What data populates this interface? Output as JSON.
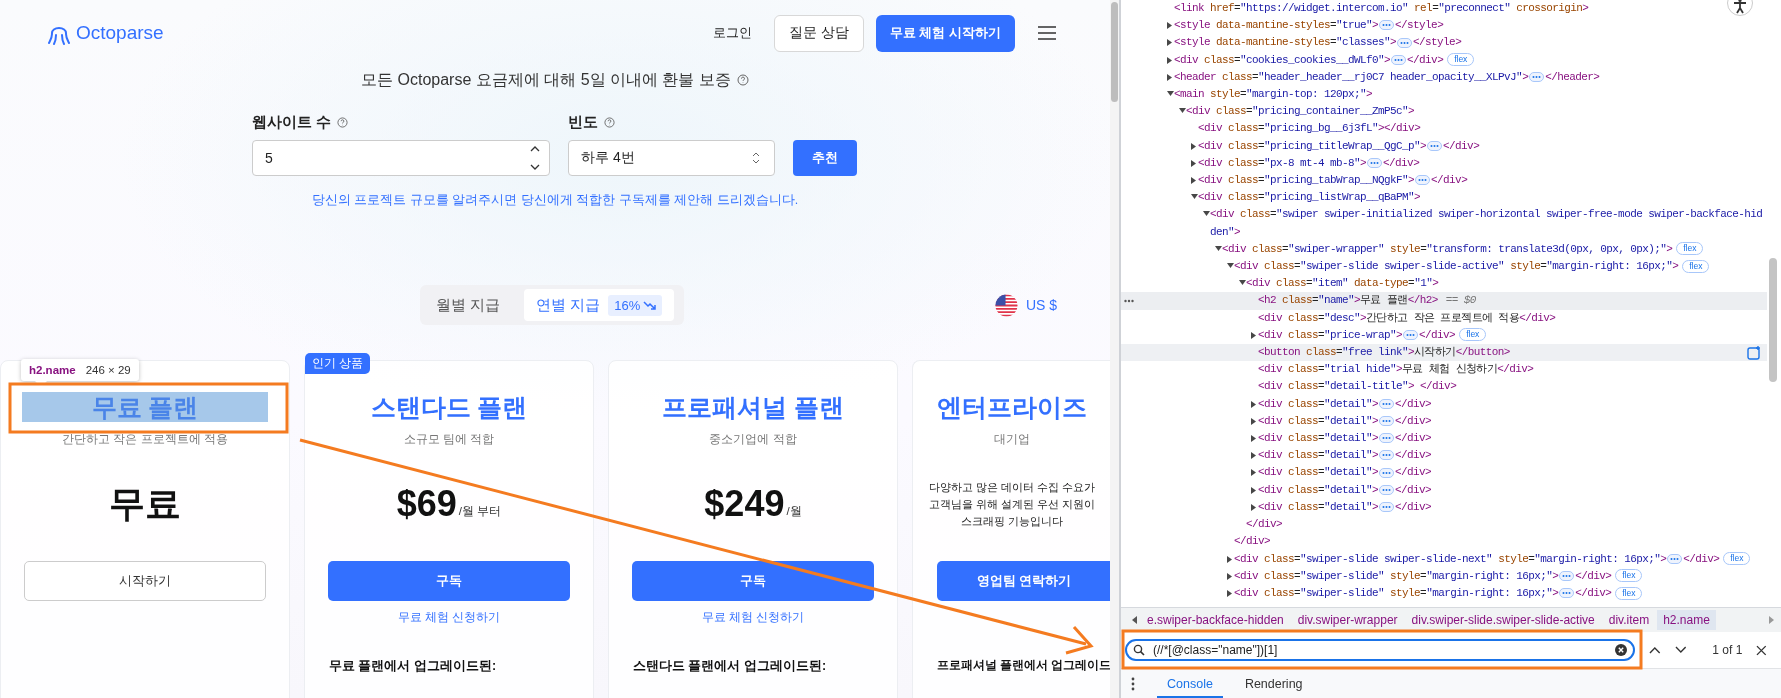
{
  "header": {
    "logo": "Octoparse",
    "login": "로그인",
    "consult": "질문 상담",
    "cta": "무료 체험 시작하기"
  },
  "guarantee": "모든 Octoparse 요금제에 대해 5일 이내에 환불 보증",
  "form": {
    "sites_label": "웹사이트 수",
    "sites_value": "5",
    "freq_label": "빈도",
    "freq_value": "하루 4번",
    "submit": "추천",
    "hint": "당신의 프로젝트 규모를 알려주시면 당신에게 적합한 구독제를 제안해 드리겠습니다."
  },
  "billing": {
    "options": [
      {
        "label": "월별 지급",
        "selected": false
      },
      {
        "label": "연별 지급",
        "selected": true,
        "discount": "16%"
      }
    ],
    "currency": "US $"
  },
  "plans": [
    {
      "name": "무료 플랜",
      "highlighted": true,
      "desc": "간단하고 작은 프로젝트에 적용",
      "price": "무료",
      "button": {
        "label": "시작하기",
        "kind": "outline"
      }
    },
    {
      "badge": "인기 상품",
      "name": "스탠다드 플랜",
      "highlighted": false,
      "desc": "소규모 팀에 적합",
      "price": "$69",
      "price_unit": "/월 부터",
      "button": {
        "label": "구독",
        "kind": "filled"
      },
      "trial": "무료 체험 신청하기",
      "upgrade": "무료 플랜에서 업그레이드된:"
    },
    {
      "name": "프로패셔널 플랜",
      "highlighted": false,
      "desc": "중소기업에 적합",
      "price": "$249",
      "price_unit": "/월",
      "button": {
        "label": "구독",
        "kind": "filled"
      },
      "trial": "무료 체험 신청하기",
      "upgrade": "스탠다드 플랜에서 업그레이드된:"
    },
    {
      "name": "엔터프라이즈",
      "highlighted": false,
      "desc": "대기업",
      "blurb": [
        "다양하고 많은 데이터 수집 수요가",
        "고객님을 위해 설계된 우선 지원이",
        "스크래핑 기능입니다"
      ],
      "button": {
        "label": "영업팀 연락하기",
        "kind": "filled"
      },
      "upgrade": "프로패셔널 플랜에서 업그레이드"
    }
  ],
  "inspector_tooltip": {
    "selector": "h2.name",
    "size": "246 × 29"
  },
  "devtools": {
    "tree": [
      {
        "open": [
          {
            "kind": "code",
            "text": "<link href=\"https://widget.intercom.io\" rel=\"preconnect\" crossorigin>"
          }
        ],
        "selected": false,
        "hovered": false
      },
      {
        "open": [
          {
            "kind": "code",
            "text": "<style data-mantine-styles=\"true\">"
          },
          {
            "kind": "more"
          },
          {
            "kind": "code",
            "text": "</style>"
          }
        ],
        "expanded": false,
        "selected": false,
        "hovered": false
      },
      {
        "open": [
          {
            "kind": "code",
            "text": "<style data-mantine-styles=\"classes\">"
          },
          {
            "kind": "more"
          },
          {
            "kind": "code",
            "text": "</style>"
          }
        ],
        "expanded": false,
        "selected": false,
        "hovered": false
      },
      {
        "open": [
          {
            "kind": "code",
            "text": "<div class=\"cookies_cookies__dWLf0\">"
          },
          {
            "kind": "more"
          },
          {
            "kind": "code",
            "text": "</div>"
          },
          {
            "kind": "badge",
            "text": "flex"
          }
        ],
        "expanded": false,
        "selected": false,
        "hovered": false
      },
      {
        "open": [
          {
            "kind": "code",
            "text": "<header class=\"header_header__rj0C7 header_opacity__XLPvJ\">"
          },
          {
            "kind": "more"
          },
          {
            "kind": "code",
            "text": "</header>"
          }
        ],
        "expanded": false,
        "selected": false,
        "hovered": false
      },
      {
        "open": [
          {
            "kind": "code",
            "text": "<main style=\"margin-top: 120px;\">"
          }
        ],
        "expanded": true,
        "selected": false,
        "hovered": false,
        "children": [
          {
            "open": [
              {
                "kind": "code",
                "text": "<div class=\"pricing_container__ZmP5c\">"
              }
            ],
            "expanded": true,
            "selected": false,
            "hovered": false,
            "children": [
              {
                "open": [
                  {
                    "kind": "code",
                    "text": "<div class=\"pricing_bg__6j3fL\"></div>"
                  }
                ],
                "selected": false,
                "hovered": false
              },
              {
                "open": [
                  {
                    "kind": "code",
                    "text": "<div class=\"pricing_titleWrap__QgC_p\">"
                  },
                  {
                    "kind": "more"
                  },
                  {
                    "kind": "code",
                    "text": "</div>"
                  }
                ],
                "expanded": false,
                "selected": false,
                "hovered": false
              },
              {
                "open": [
                  {
                    "kind": "code",
                    "text": "<div class=\"px-8 mt-4 mb-8\">"
                  },
                  {
                    "kind": "more"
                  },
                  {
                    "kind": "code",
                    "text": "</div>"
                  }
                ],
                "expanded": false,
                "selected": false,
                "hovered": false
              },
              {
                "open": [
                  {
                    "kind": "code",
                    "text": "<div class=\"pricing_tabWrap__NQgkF\">"
                  },
                  {
                    "kind": "more"
                  },
                  {
                    "kind": "code",
                    "text": "</div>"
                  }
                ],
                "expanded": false,
                "selected": false,
                "hovered": false
              },
              {
                "open": [
                  {
                    "kind": "code",
                    "text": "<div class=\"pricing_listWrap__qBaPM\">"
                  }
                ],
                "expanded": true,
                "selected": false,
                "hovered": false,
                "children": [
                  {
                    "open": [
                      {
                        "kind": "code",
                        "text": "<div class=\"swiper swiper-initialized swiper-horizontal swiper-free-mode swiper-backface-hidden\">"
                      }
                    ],
                    "expanded": true,
                    "selected": false,
                    "hovered": false,
                    "children": [
                      {
                        "open": [
                          {
                            "kind": "code",
                            "text": "<div class=\"swiper-wrapper\" style=\"transform: translate3d(0px, 0px, 0px);\">"
                          },
                          {
                            "kind": "badge",
                            "text": "flex"
                          }
                        ],
                        "expanded": true,
                        "selected": false,
                        "hovered": false,
                        "children": [
                          {
                            "open": [
                              {
                                "kind": "code",
                                "text": "<div class=\"swiper-slide swiper-slide-active\" style=\"margin-right: 16px;\">"
                              },
                              {
                                "kind": "badge",
                                "text": "flex"
                              }
                            ],
                            "expanded": true,
                            "selected": false,
                            "hovered": false,
                            "close": [
                              {
                                "kind": "code",
                                "text": "</div>"
                              }
                            ],
                            "children": [
                              {
                                "open": [
                                  {
                                    "kind": "code",
                                    "text": "<div class=\"item\" data-type=\"1\">"
                                  }
                                ],
                                "expanded": true,
                                "selected": false,
                                "hovered": false,
                                "close": [
                                  {
                                    "kind": "code",
                                    "text": "</div>"
                                  }
                                ],
                                "children": [
                                  {
                                    "open": [
                                      {
                                        "kind": "code",
                                        "text": "<h2 class=\"name\">무료 플랜</h2>"
                                      },
                                      {
                                        "kind": "ref",
                                        "text": "== $0"
                                      }
                                    ],
                                    "selected": true,
                                    "hovered": false
                                  },
                                  {
                                    "open": [
                                      {
                                        "kind": "code",
                                        "text": "<div class=\"desc\">간단하고 작은 프로젝트에 적용</div>"
                                      }
                                    ],
                                    "selected": false,
                                    "hovered": false
                                  },
                                  {
                                    "open": [
                                      {
                                        "kind": "code",
                                        "text": "<div class=\"price-wrap\">"
                                      },
                                      {
                                        "kind": "more"
                                      },
                                      {
                                        "kind": "code",
                                        "text": "</div>"
                                      },
                                      {
                                        "kind": "badge",
                                        "text": "flex"
                                      }
                                    ],
                                    "expanded": false,
                                    "selected": false,
                                    "hovered": false
                                  },
                                  {
                                    "open": [
                                      {
                                        "kind": "code",
                                        "text": "<button class=\"free link\">시작하기</button>"
                                      }
                                    ],
                                    "selected": false,
                                    "hovered": true
                                  },
                                  {
                                    "open": [
                                      {
                                        "kind": "code",
                                        "text": "<div class=\"trial hide\">무료 체험 신청하기</div>"
                                      }
                                    ],
                                    "selected": false,
                                    "hovered": false
                                  },
                                  {
                                    "open": [
                                      {
                                        "kind": "code",
                                        "text": "<div class=\"detail-title\"> </div>"
                                      }
                                    ],
                                    "selected": false,
                                    "hovered": false
                                  },
                                  {
                                    "open": [
                                      {
                                        "kind": "code",
                                        "text": "<div class=\"detail\">"
                                      },
                                      {
                                        "kind": "more"
                                      },
                                      {
                                        "kind": "code",
                                        "text": "</div>"
                                      }
                                    ],
                                    "expanded": false,
                                    "selected": false,
                                    "hovered": false
                                  },
                                  {
                                    "open": [
                                      {
                                        "kind": "code",
                                        "text": "<div class=\"detail\">"
                                      },
                                      {
                                        "kind": "more"
                                      },
                                      {
                                        "kind": "code",
                                        "text": "</div>"
                                      }
                                    ],
                                    "expanded": false,
                                    "selected": false,
                                    "hovered": false
                                  },
                                  {
                                    "open": [
                                      {
                                        "kind": "code",
                                        "text": "<div class=\"detail\">"
                                      },
                                      {
                                        "kind": "more"
                                      },
                                      {
                                        "kind": "code",
                                        "text": "</div>"
                                      }
                                    ],
                                    "expanded": false,
                                    "selected": false,
                                    "hovered": false
                                  },
                                  {
                                    "open": [
                                      {
                                        "kind": "code",
                                        "text": "<div class=\"detail\">"
                                      },
                                      {
                                        "kind": "more"
                                      },
                                      {
                                        "kind": "code",
                                        "text": "</div>"
                                      }
                                    ],
                                    "expanded": false,
                                    "selected": false,
                                    "hovered": false
                                  },
                                  {
                                    "open": [
                                      {
                                        "kind": "code",
                                        "text": "<div class=\"detail\">"
                                      },
                                      {
                                        "kind": "more"
                                      },
                                      {
                                        "kind": "code",
                                        "text": "</div>"
                                      }
                                    ],
                                    "expanded": false,
                                    "selected": false,
                                    "hovered": false
                                  },
                                  {
                                    "open": [
                                      {
                                        "kind": "code",
                                        "text": "<div class=\"detail\">"
                                      },
                                      {
                                        "kind": "more"
                                      },
                                      {
                                        "kind": "code",
                                        "text": "</div>"
                                      }
                                    ],
                                    "expanded": false,
                                    "selected": false,
                                    "hovered": false
                                  },
                                  {
                                    "open": [
                                      {
                                        "kind": "code",
                                        "text": "<div class=\"detail\">"
                                      },
                                      {
                                        "kind": "more"
                                      },
                                      {
                                        "kind": "code",
                                        "text": "</div>"
                                      }
                                    ],
                                    "expanded": false,
                                    "selected": false,
                                    "hovered": false
                                  }
                                ]
                              }
                            ]
                          },
                          {
                            "open": [
                              {
                                "kind": "code",
                                "text": "<div class=\"swiper-slide swiper-slide-next\" style=\"margin-right: 16px;\">"
                              },
                              {
                                "kind": "more"
                              },
                              {
                                "kind": "code",
                                "text": "</div>"
                              },
                              {
                                "kind": "badge",
                                "text": "flex"
                              }
                            ],
                            "expanded": false,
                            "selected": false,
                            "hovered": false
                          },
                          {
                            "open": [
                              {
                                "kind": "code",
                                "text": "<div class=\"swiper-slide\" style=\"margin-right: 16px;\">"
                              },
                              {
                                "kind": "more"
                              },
                              {
                                "kind": "code",
                                "text": "</div>"
                              },
                              {
                                "kind": "badge",
                                "text": "flex"
                              }
                            ],
                            "expanded": false,
                            "selected": false,
                            "hovered": false
                          },
                          {
                            "open": [
                              {
                                "kind": "code",
                                "text": "<div class=\"swiper-slide\" style=\"margin-right: 16px;\">"
                              },
                              {
                                "kind": "more"
                              },
                              {
                                "kind": "code",
                                "text": "</div>"
                              },
                              {
                                "kind": "badge",
                                "text": "flex"
                              }
                            ],
                            "expanded": false,
                            "selected": false,
                            "hovered": false
                          }
                        ]
                      }
                    ]
                  }
                ]
              }
            ]
          }
        ]
      }
    ],
    "breadcrumbs": [
      {
        "label": "e.swiper-backface-hidden",
        "selected": false
      },
      {
        "label": "div.swiper-wrapper",
        "selected": false
      },
      {
        "label": "div.swiper-slide.swiper-slide-active",
        "selected": false
      },
      {
        "label": "div.item",
        "selected": false
      },
      {
        "label": "h2.name",
        "selected": true
      }
    ],
    "search": {
      "value": "(//*[@class=\"name\"])[1]",
      "count": "1 of 1"
    },
    "tabs": [
      {
        "label": "Console",
        "selected": true
      },
      {
        "label": "Rendering",
        "selected": false
      }
    ]
  }
}
